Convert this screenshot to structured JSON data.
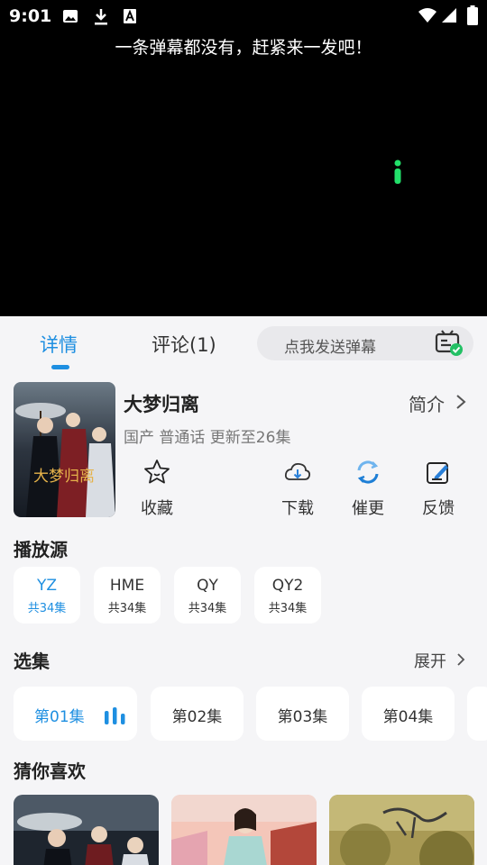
{
  "status_bar": {
    "time": "9:01",
    "left_icons": [
      "image-icon",
      "download-icon",
      "text-icon"
    ],
    "right_icons": [
      "wifi-icon",
      "signal-icon",
      "battery-icon"
    ]
  },
  "player": {
    "danmaku_hint": "一条弹幕都没有，赶紧来一发吧！",
    "info_icon": "info-icon",
    "accent_color": "#22e06a"
  },
  "tabs": {
    "detail": "详情",
    "comment": "评论(1)",
    "danmaku_placeholder": "点我发送弹幕",
    "active_color": "#1e8fe1"
  },
  "show": {
    "title": "大梦归离",
    "intro_label": "简介",
    "meta": "国产 普通话 更新至26集",
    "poster_text": "大梦归离"
  },
  "actions": [
    {
      "label": "收藏",
      "icon": "star-icon"
    },
    {
      "label": "下载",
      "icon": "cloud-download-icon"
    },
    {
      "label": "催更",
      "icon": "refresh-icon"
    },
    {
      "label": "反馈",
      "icon": "feedback-icon"
    }
  ],
  "sources": {
    "title": "播放源",
    "items": [
      {
        "name": "YZ",
        "count": "共34集"
      },
      {
        "name": "HME",
        "count": "共34集"
      },
      {
        "name": "QY",
        "count": "共34集"
      },
      {
        "name": "QY2",
        "count": "共34集"
      }
    ]
  },
  "episodes": {
    "title": "选集",
    "expand_label": "展开",
    "items": [
      "第01集",
      "第02集",
      "第03集",
      "第04集"
    ]
  },
  "recommend": {
    "title": "猜你喜欢"
  }
}
